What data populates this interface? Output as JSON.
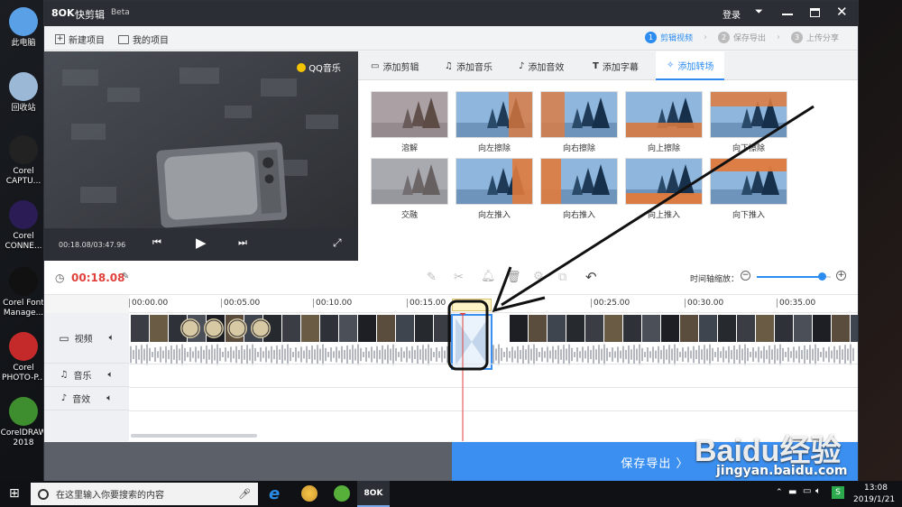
{
  "desktop": {
    "icons": [
      {
        "label": "此电脑",
        "color": "#5aa0e6"
      },
      {
        "label": "回收站",
        "color": "#9bb8d6"
      },
      {
        "label": "Corel CAPTU...",
        "color": "#222"
      },
      {
        "label": "Corel CONNE...",
        "color": "#2b1c55"
      },
      {
        "label": "Corel Font Manage...",
        "color": "#111"
      },
      {
        "label": "Corel PHOTO-P...",
        "color": "#c42a2a"
      },
      {
        "label": "CorelDRAW 2018",
        "color": "#3e8e2f"
      }
    ]
  },
  "app": {
    "logo": "8OK",
    "name": "快剪辑",
    "beta": "Beta",
    "login": "登录"
  },
  "toolbar": {
    "new_project": "新建项目",
    "my_projects": "我的项目",
    "steps": [
      {
        "num": "1",
        "label": "剪辑视频"
      },
      {
        "num": "2",
        "label": "保存导出"
      },
      {
        "num": "3",
        "label": "上传分享"
      }
    ]
  },
  "preview": {
    "watermark": "QQ音乐",
    "time": "00:18.08/03:47.96"
  },
  "tabs": [
    "添加剪辑",
    "添加音乐",
    "添加音效",
    "添加字幕",
    "添加转场"
  ],
  "transitions": [
    {
      "label": "溶解",
      "style": "dissolve"
    },
    {
      "label": "向左擦除",
      "style": "wipe-left"
    },
    {
      "label": "向右擦除",
      "style": "wipe-right"
    },
    {
      "label": "向上擦除",
      "style": "wipe-up"
    },
    {
      "label": "向下擦除",
      "style": "wipe-down"
    },
    {
      "label": "交融",
      "style": "blend"
    },
    {
      "label": "向左推入",
      "style": "push-left"
    },
    {
      "label": "向右推入",
      "style": "push-right"
    },
    {
      "label": "向上推入",
      "style": "push-up"
    },
    {
      "label": "向下推入",
      "style": "push-down"
    }
  ],
  "timeline": {
    "current": "00:18.08",
    "zoom_label": "时间轴缩放：",
    "zoom_level": 0.88,
    "ticks": [
      "00:00.00",
      "00:05.00",
      "00:10.00",
      "00:15.00",
      "00:25.00",
      "00:30.00",
      "00:35.00"
    ]
  },
  "tracks": {
    "video": "视频",
    "music": "音乐",
    "sfx": "音效"
  },
  "export": {
    "label": "保存导出 〉"
  },
  "taskbar": {
    "search_placeholder": "在这里输入你要搜索的内容",
    "time": "13:08",
    "date": "2019/1/21",
    "lang": "S"
  },
  "watermark": {
    "brand": "Baidu经验",
    "url": "jingyan.baidu.com"
  },
  "colors": {
    "accent": "#2d8cf0",
    "time_red": "#e0413c",
    "export_blue": "#3a8ff0"
  }
}
